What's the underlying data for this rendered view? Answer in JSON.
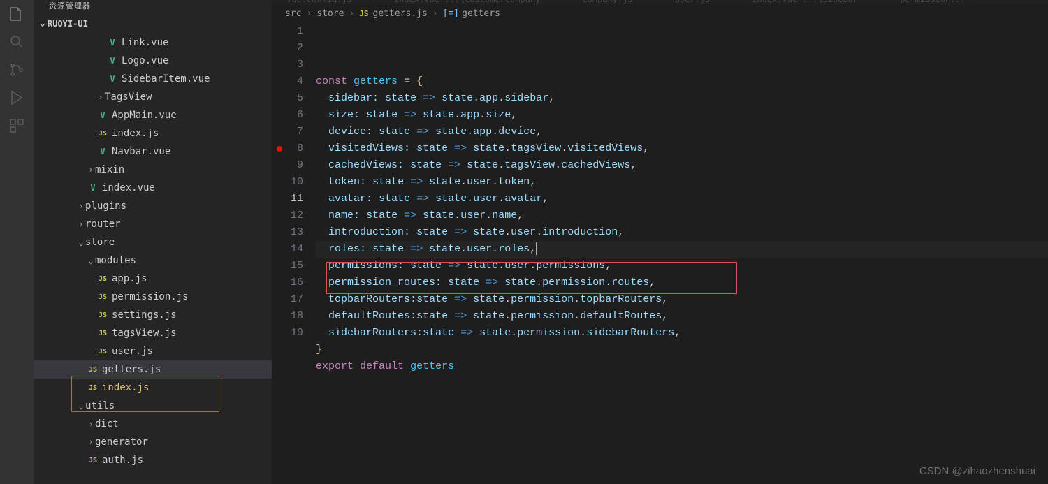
{
  "sidebar": {
    "title": "资源管理器",
    "project": "RUOYI-UI",
    "tree": [
      {
        "indent": 3,
        "icon": "vue",
        "label": "Link.vue"
      },
      {
        "indent": 3,
        "icon": "vue",
        "label": "Logo.vue"
      },
      {
        "indent": 3,
        "icon": "vue",
        "label": "SidebarItem.vue"
      },
      {
        "indent": 2,
        "chev": ">",
        "label": "TagsView"
      },
      {
        "indent": 2,
        "icon": "vue",
        "label": "AppMain.vue"
      },
      {
        "indent": 2,
        "icon": "js",
        "label": "index.js"
      },
      {
        "indent": 2,
        "icon": "vue",
        "label": "Navbar.vue"
      },
      {
        "indent": 1,
        "chev": ">",
        "label": "mixin"
      },
      {
        "indent": 1,
        "icon": "vue",
        "label": "index.vue"
      },
      {
        "indent": 0,
        "chev": ">",
        "label": "plugins"
      },
      {
        "indent": 0,
        "chev": ">",
        "label": "router"
      },
      {
        "indent": 0,
        "chev": "v",
        "label": "store"
      },
      {
        "indent": 1,
        "chev": "v",
        "label": "modules"
      },
      {
        "indent": 2,
        "icon": "js",
        "label": "app.js"
      },
      {
        "indent": 2,
        "icon": "js",
        "label": "permission.js"
      },
      {
        "indent": 2,
        "icon": "js",
        "label": "settings.js"
      },
      {
        "indent": 2,
        "icon": "js",
        "label": "tagsView.js"
      },
      {
        "indent": 2,
        "icon": "js",
        "label": "user.js"
      },
      {
        "indent": 1,
        "icon": "js",
        "label": "getters.js",
        "active": true
      },
      {
        "indent": 1,
        "icon": "js",
        "label": "index.js",
        "modified": true
      },
      {
        "indent": 0,
        "chev": "v",
        "label": "utils"
      },
      {
        "indent": 1,
        "chev": ">",
        "label": "dict"
      },
      {
        "indent": 1,
        "chev": ">",
        "label": "generator"
      },
      {
        "indent": 1,
        "icon": "js",
        "label": "auth.js"
      }
    ]
  },
  "tabs": [
    "vue.config.js",
    "index.vue ...\\customerCompany",
    "company.js",
    "user.js",
    "index.vue ...\\Sidebar",
    "permission..."
  ],
  "breadcrumb": {
    "parts": [
      "src",
      "store",
      "getters.js",
      "getters"
    ],
    "fileIcon": "JS",
    "symIcon": "[≡]"
  },
  "editor": {
    "currentLine": 11,
    "breakpointLine": 8,
    "lines": [
      {
        "n": 1,
        "html": "<span class='tok-kw'>const</span> <span class='tok-var'>getters</span> <span class='tok-op'>=</span> <span class='tok-punct-y'>{</span>"
      },
      {
        "n": 2,
        "html": "  <span class='tok-prop'>sidebar</span><span class='tok-prop'>:</span> <span class='tok-obj'>state</span> <span class='tok-arrow'>=&gt;</span> <span class='tok-obj'>state</span><span class='tok-punct'>.</span><span class='tok-obj'>app</span><span class='tok-punct'>.</span><span class='tok-obj'>sidebar</span><span class='tok-punct'>,</span>"
      },
      {
        "n": 3,
        "html": "  <span class='tok-prop'>size</span><span class='tok-prop'>:</span> <span class='tok-obj'>state</span> <span class='tok-arrow'>=&gt;</span> <span class='tok-obj'>state</span><span class='tok-punct'>.</span><span class='tok-obj'>app</span><span class='tok-punct'>.</span><span class='tok-obj'>size</span><span class='tok-punct'>,</span>"
      },
      {
        "n": 4,
        "html": "  <span class='tok-prop'>device</span><span class='tok-prop'>:</span> <span class='tok-obj'>state</span> <span class='tok-arrow'>=&gt;</span> <span class='tok-obj'>state</span><span class='tok-punct'>.</span><span class='tok-obj'>app</span><span class='tok-punct'>.</span><span class='tok-obj'>device</span><span class='tok-punct'>,</span>"
      },
      {
        "n": 5,
        "html": "  <span class='tok-prop'>visitedViews</span><span class='tok-prop'>:</span> <span class='tok-obj'>state</span> <span class='tok-arrow'>=&gt;</span> <span class='tok-obj'>state</span><span class='tok-punct'>.</span><span class='tok-obj'>tagsView</span><span class='tok-punct'>.</span><span class='tok-obj'>visitedViews</span><span class='tok-punct'>,</span>"
      },
      {
        "n": 6,
        "html": "  <span class='tok-prop'>cachedViews</span><span class='tok-prop'>:</span> <span class='tok-obj'>state</span> <span class='tok-arrow'>=&gt;</span> <span class='tok-obj'>state</span><span class='tok-punct'>.</span><span class='tok-obj'>tagsView</span><span class='tok-punct'>.</span><span class='tok-obj'>cachedViews</span><span class='tok-punct'>,</span>"
      },
      {
        "n": 7,
        "html": "  <span class='tok-prop'>token</span><span class='tok-prop'>:</span> <span class='tok-obj'>state</span> <span class='tok-arrow'>=&gt;</span> <span class='tok-obj'>state</span><span class='tok-punct'>.</span><span class='tok-obj'>user</span><span class='tok-punct'>.</span><span class='tok-obj'>token</span><span class='tok-punct'>,</span>"
      },
      {
        "n": 8,
        "html": "  <span class='tok-prop'>avatar</span><span class='tok-prop'>:</span> <span class='tok-obj'>state</span> <span class='tok-arrow'>=&gt;</span> <span class='tok-obj'>state</span><span class='tok-punct'>.</span><span class='tok-obj'>user</span><span class='tok-punct'>.</span><span class='tok-obj'>avatar</span><span class='tok-punct'>,</span>"
      },
      {
        "n": 9,
        "html": "  <span class='tok-prop'>name</span><span class='tok-prop'>:</span> <span class='tok-obj'>state</span> <span class='tok-arrow'>=&gt;</span> <span class='tok-obj'>state</span><span class='tok-punct'>.</span><span class='tok-obj'>user</span><span class='tok-punct'>.</span><span class='tok-obj'>name</span><span class='tok-punct'>,</span>"
      },
      {
        "n": 10,
        "html": "  <span class='tok-prop'>introduction</span><span class='tok-prop'>:</span> <span class='tok-obj'>state</span> <span class='tok-arrow'>=&gt;</span> <span class='tok-obj'>state</span><span class='tok-punct'>.</span><span class='tok-obj'>user</span><span class='tok-punct'>.</span><span class='tok-obj'>introduction</span><span class='tok-punct'>,</span>"
      },
      {
        "n": 11,
        "html": "  <span class='tok-prop'>roles</span><span class='tok-prop'>:</span> <span class='tok-obj'>state</span> <span class='tok-arrow'>=&gt;</span> <span class='tok-obj'>state</span><span class='tok-punct'>.</span><span class='tok-obj'>user</span><span class='tok-punct'>.</span><span class='tok-obj'>roles</span><span class='tok-punct'>,</span><span style='border-left:1px solid #aeafad; display:inline-block; height:18px; vertical-align:middle'></span>"
      },
      {
        "n": 12,
        "html": "  <span class='tok-prop'>permissions</span><span class='tok-prop'>:</span> <span class='tok-obj'>state</span> <span class='tok-arrow'>=&gt;</span> <span class='tok-obj'>state</span><span class='tok-punct'>.</span><span class='tok-obj'>user</span><span class='tok-punct'>.</span><span class='tok-obj'>permissions</span><span class='tok-punct'>,</span>"
      },
      {
        "n": 13,
        "html": "  <span class='tok-prop'>permission_routes</span><span class='tok-prop'>:</span> <span class='tok-obj'>state</span> <span class='tok-arrow'>=&gt;</span> <span class='tok-obj'>state</span><span class='tok-punct'>.</span><span class='tok-obj'>permission</span><span class='tok-punct'>.</span><span class='tok-obj'>routes</span><span class='tok-punct'>,</span>"
      },
      {
        "n": 14,
        "html": "  <span class='tok-prop'>topbarRouters</span><span class='tok-prop'>:</span><span class='tok-obj'>state</span> <span class='tok-arrow'>=&gt;</span> <span class='tok-obj'>state</span><span class='tok-punct'>.</span><span class='tok-obj'>permission</span><span class='tok-punct'>.</span><span class='tok-obj'>topbarRouters</span><span class='tok-punct'>,</span>"
      },
      {
        "n": 15,
        "html": "  <span class='tok-prop'>defaultRoutes</span><span class='tok-prop'>:</span><span class='tok-obj'>state</span> <span class='tok-arrow'>=&gt;</span> <span class='tok-obj'>state</span><span class='tok-punct'>.</span><span class='tok-obj'>permission</span><span class='tok-punct'>.</span><span class='tok-obj'>defaultRoutes</span><span class='tok-punct'>,</span>"
      },
      {
        "n": 16,
        "html": "  <span class='tok-prop'>sidebarRouters</span><span class='tok-prop'>:</span><span class='tok-obj'>state</span> <span class='tok-arrow'>=&gt;</span> <span class='tok-obj'>state</span><span class='tok-punct'>.</span><span class='tok-obj'>permission</span><span class='tok-punct'>.</span><span class='tok-obj'>sidebarRouters</span><span class='tok-punct'>,</span>"
      },
      {
        "n": 17,
        "html": "<span class='tok-punct-y'>}</span>"
      },
      {
        "n": 18,
        "html": "<span class='tok-kw'>export</span> <span class='tok-kw'>default</span> <span class='tok-var'>getters</span>"
      },
      {
        "n": 19,
        "html": ""
      }
    ]
  },
  "watermark": "CSDN @zihaozhenshuai"
}
